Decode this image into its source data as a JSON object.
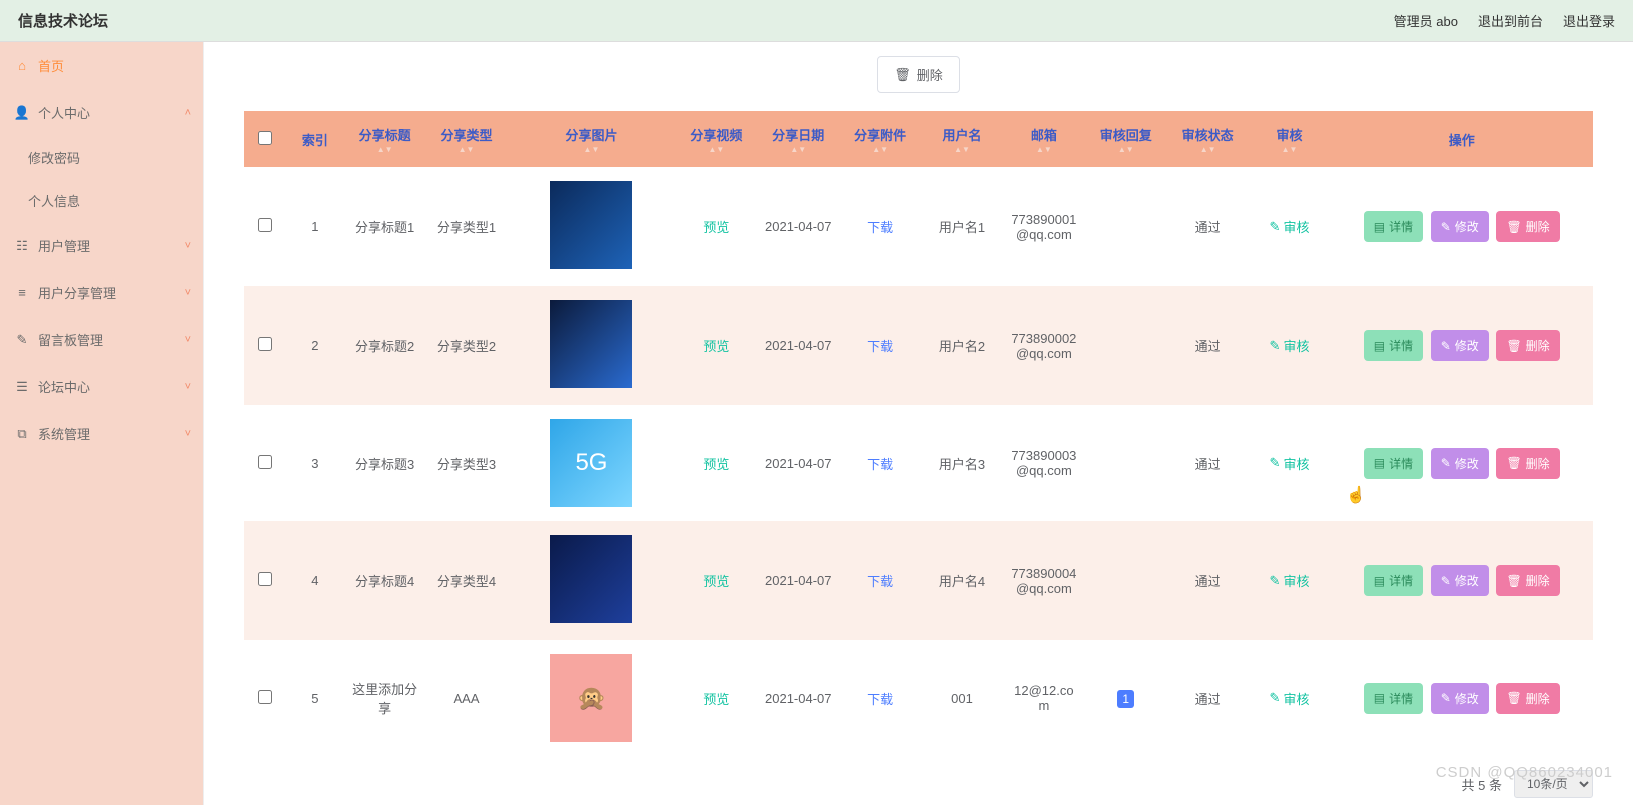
{
  "topbar": {
    "title": "信息技术论坛",
    "admin": "管理员 abo",
    "backFront": "退出到前台",
    "logout": "退出登录"
  },
  "sidebar": {
    "home": "首页",
    "personal": "个人中心",
    "pwd": "修改密码",
    "info": "个人信息",
    "userMgmt": "用户管理",
    "shareMgmt": "用户分享管理",
    "msgBoard": "留言板管理",
    "forum": "论坛中心",
    "system": "系统管理"
  },
  "toolbar": {
    "delete": "删除"
  },
  "columns": {
    "index": "索引",
    "title": "分享标题",
    "type": "分享类型",
    "image": "分享图片",
    "video": "分享视频",
    "date": "分享日期",
    "file": "分享附件",
    "user": "用户名",
    "mail": "邮箱",
    "reply": "审核回复",
    "status": "审核状态",
    "audit": "审核",
    "ops": "操作"
  },
  "cell": {
    "preview": "预览",
    "download": "下载",
    "pass": "通过",
    "audit": "审核",
    "detail": "详情",
    "modify": "修改",
    "delete": "删除"
  },
  "rows": [
    {
      "idx": "1",
      "title": "分享标题1",
      "type": "分享类型1",
      "date": "2021-04-07",
      "user": "用户名1",
      "mail": "773890001@qq.com",
      "reply": "",
      "thumb": "th1"
    },
    {
      "idx": "2",
      "title": "分享标题2",
      "type": "分享类型2",
      "date": "2021-04-07",
      "user": "用户名2",
      "mail": "773890002@qq.com",
      "reply": "",
      "thumb": "th2"
    },
    {
      "idx": "3",
      "title": "分享标题3",
      "type": "分享类型3",
      "date": "2021-04-07",
      "user": "用户名3",
      "mail": "773890003@qq.com",
      "reply": "",
      "thumb": "th3",
      "thumbText": "5G"
    },
    {
      "idx": "4",
      "title": "分享标题4",
      "type": "分享类型4",
      "date": "2021-04-07",
      "user": "用户名4",
      "mail": "773890004@qq.com",
      "reply": "",
      "thumb": "th4"
    },
    {
      "idx": "5",
      "title": "这里添加分享",
      "type": "AAA",
      "date": "2021-04-07",
      "user": "001",
      "mail": "12@12.com",
      "reply": "1",
      "thumb": "th5",
      "thumbText": "🙊"
    }
  ],
  "pager": {
    "total": "共 5 条",
    "perPage": "10条/页"
  },
  "watermark": "CSDN @QQ860234001"
}
